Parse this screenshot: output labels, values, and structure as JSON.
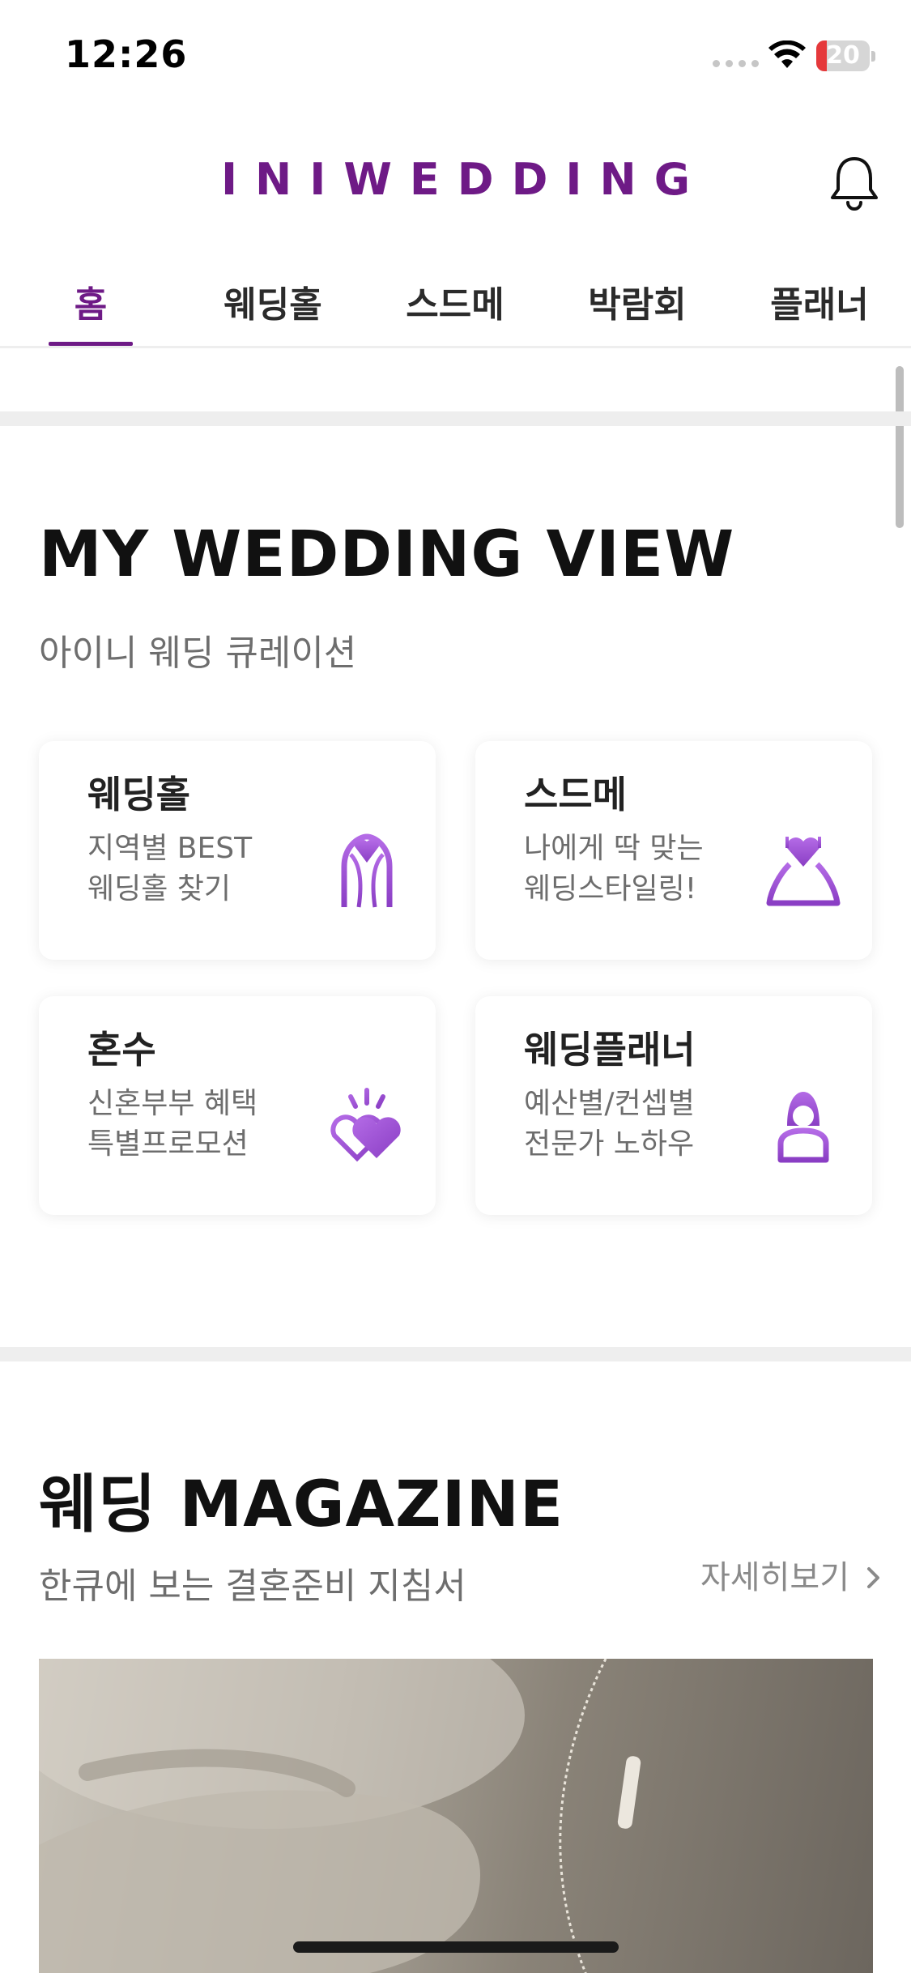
{
  "status_bar": {
    "time": "12:26",
    "battery_level": "20",
    "battery_fraction": 0.2,
    "battery_color": "#e5393b"
  },
  "header": {
    "logo": "INIWEDDING",
    "brand_color": "#6e1a86",
    "bell_icon": "bell-icon"
  },
  "tabs": [
    {
      "label": "홈",
      "active": true
    },
    {
      "label": "웨딩홀",
      "active": false
    },
    {
      "label": "스드메",
      "active": false
    },
    {
      "label": "박람회",
      "active": false
    },
    {
      "label": "플래너",
      "active": false
    }
  ],
  "my_wedding_view": {
    "title": "MY WEDDING VIEW",
    "subtitle": "아이니 웨딩 큐레이션",
    "cards": [
      {
        "title": "웨딩홀",
        "desc_line1": "지역별 BEST",
        "desc_line2": "웨딩홀 찾기",
        "icon": "wedding-arch-icon"
      },
      {
        "title": "스드메",
        "desc_line1": "나에게 딱 맞는",
        "desc_line2": "웨딩스타일링!",
        "icon": "wedding-dress-icon"
      },
      {
        "title": "혼수",
        "desc_line1": "신혼부부 혜택",
        "desc_line2": "특별프로모션",
        "icon": "hearts-icon"
      },
      {
        "title": "웨딩플래너",
        "desc_line1": "예산별/컨셉별",
        "desc_line2": "전문가 노하우",
        "icon": "planner-icon"
      }
    ],
    "icon_color": "#9b4fd0"
  },
  "magazine": {
    "title": "웨딩 MAGAZINE",
    "subtitle": "한큐에 보는 결혼준비 지침서",
    "more_label": "자세히보기",
    "more_icon": "chevron-right-icon"
  }
}
